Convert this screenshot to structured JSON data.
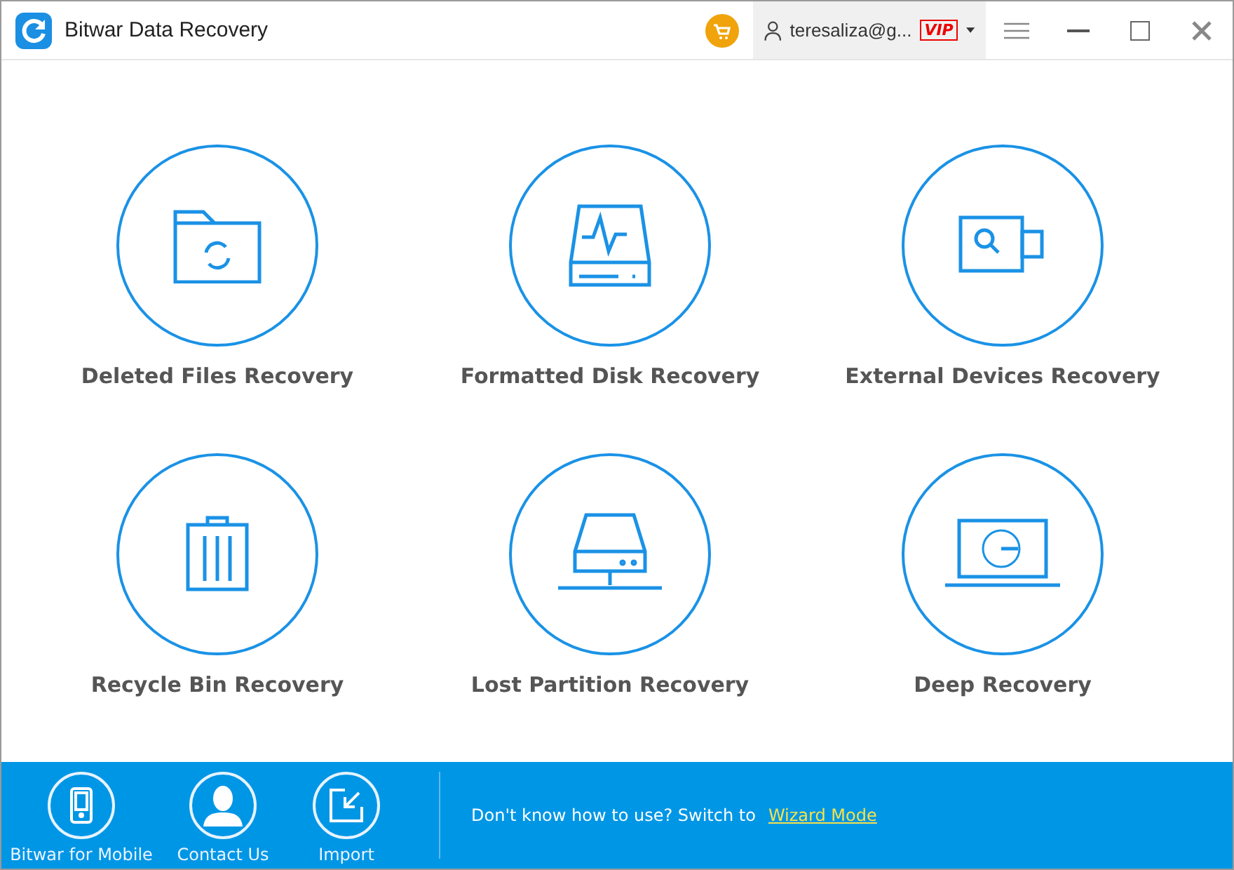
{
  "window": {
    "title": "Bitwar Data Recovery"
  },
  "account": {
    "user": "teresaliza@g...",
    "badge": "VIP"
  },
  "modes": [
    {
      "label": "Deleted Files Recovery",
      "kind": "folder"
    },
    {
      "label": "Formatted Disk Recovery",
      "kind": "disk"
    },
    {
      "label": "External Devices Recovery",
      "kind": "usb"
    },
    {
      "label": "Recycle Bin Recovery",
      "kind": "bin"
    },
    {
      "label": "Lost Partition Recovery",
      "kind": "partition"
    },
    {
      "label": "Deep Recovery",
      "kind": "laptop"
    }
  ],
  "footer": {
    "items": [
      {
        "label": "Bitwar for Mobile",
        "kind": "mobile"
      },
      {
        "label": "Contact Us",
        "kind": "contact"
      },
      {
        "label": "Import",
        "kind": "import"
      }
    ],
    "hint": "Don't know how to use? Switch to",
    "link": "Wizard Mode"
  }
}
